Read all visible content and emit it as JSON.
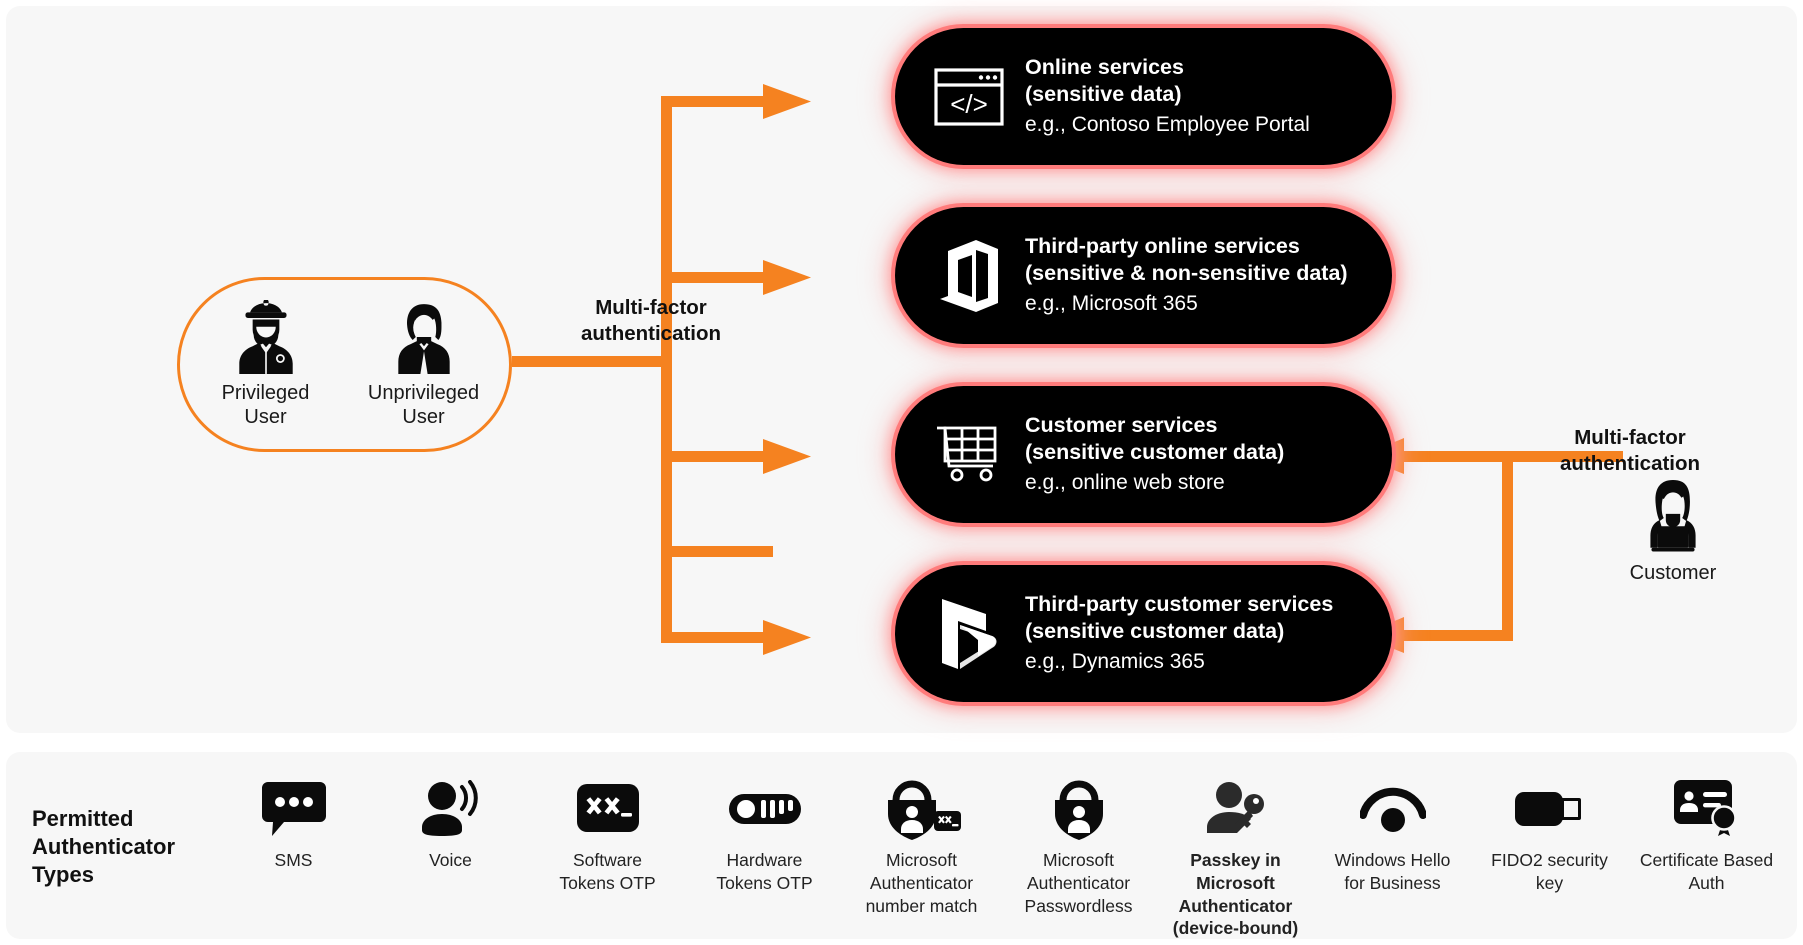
{
  "diagram": {
    "users_group": {
      "items": [
        {
          "icon": "police-officer-icon",
          "label": "Privileged\nUser"
        },
        {
          "icon": "businesswoman-icon",
          "label": "Unprivileged\nUser"
        }
      ]
    },
    "labels": {
      "mfa_left": "Multi-factor\nauthentication",
      "mfa_right": "Multi-factor\nauthentication"
    },
    "customer": {
      "icon": "customer-laptop-icon",
      "label": "Customer"
    },
    "services": [
      {
        "icon": "code-window-icon",
        "title": "Online services",
        "subtitle": "(sensitive data)",
        "example": "e.g., Contoso Employee Portal"
      },
      {
        "icon": "office-365-icon",
        "title": "Third-party online services",
        "subtitle": "(sensitive & non-sensitive data)",
        "example": "e.g., Microsoft 365"
      },
      {
        "icon": "shopping-cart-icon",
        "title": "Customer services",
        "subtitle": "(sensitive customer data)",
        "example": "e.g., online web store"
      },
      {
        "icon": "dynamics-365-icon",
        "title": "Third-party customer services",
        "subtitle": "(sensitive customer data)",
        "example": "e.g., Dynamics 365"
      }
    ]
  },
  "authenticators": {
    "title": "Permitted\nAuthenticator\nTypes",
    "items": [
      {
        "icon": "sms-chat-icon",
        "label": "SMS",
        "bold": false
      },
      {
        "icon": "voice-person-icon",
        "label": "Voice",
        "bold": false
      },
      {
        "icon": "software-token-icon",
        "label": "Software\nTokens OTP",
        "bold": false
      },
      {
        "icon": "hardware-token-icon",
        "label": "Hardware\nTokens OTP",
        "bold": false
      },
      {
        "icon": "lock-person-keypad-icon",
        "label": "Microsoft\nAuthenticator\nnumber match",
        "bold": false
      },
      {
        "icon": "lock-person-icon",
        "label": "Microsoft\nAuthenticator\nPasswordless",
        "bold": false
      },
      {
        "icon": "passkey-person-key-icon",
        "label": "Passkey in\nMicrosoft\nAuthenticator\n(device-bound)",
        "bold": true
      },
      {
        "icon": "windows-hello-icon",
        "label": "Windows Hello\nfor Business",
        "bold": false
      },
      {
        "icon": "fido2-key-icon",
        "label": "FIDO2 security\nkey",
        "bold": false
      },
      {
        "icon": "certificate-badge-icon",
        "label": "Certificate Based\nAuth",
        "bold": false
      }
    ]
  },
  "colors": {
    "accent_orange": "#f58220",
    "panel_bg": "#f7f7f7",
    "pill_bg": "#000000",
    "pill_glow": "#ff8080",
    "text_dark": "#1a1a1a",
    "text_light": "#ffffff"
  }
}
